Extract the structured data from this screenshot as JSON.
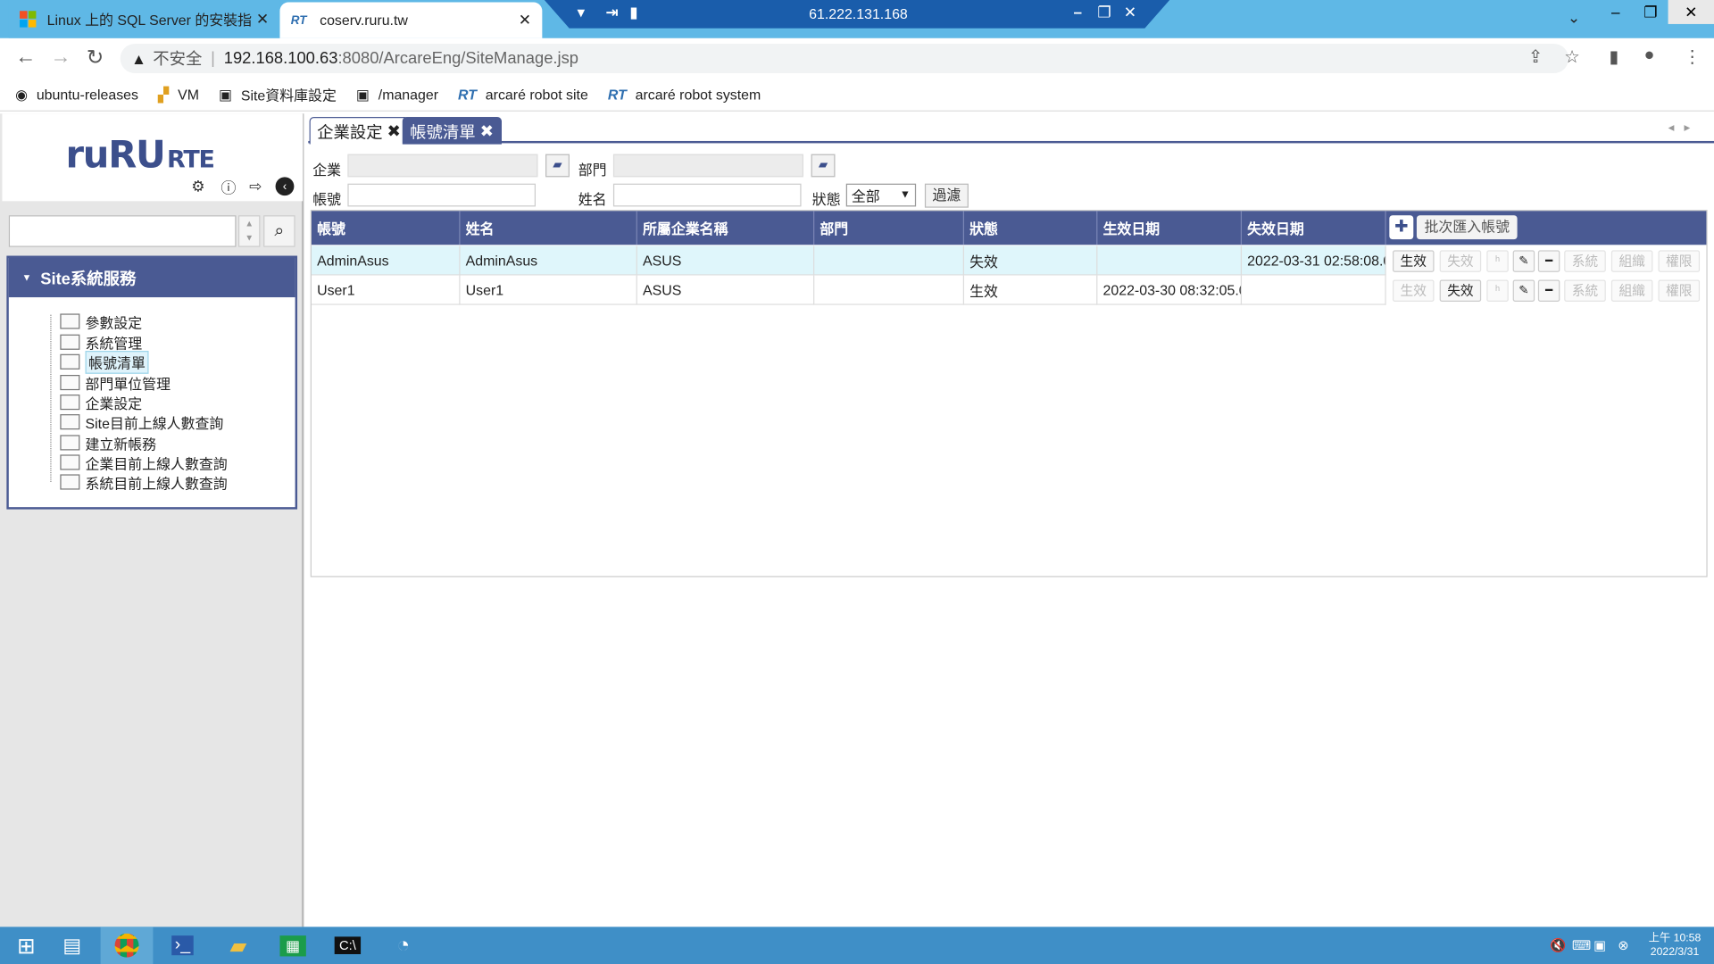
{
  "browser": {
    "tabs": [
      {
        "title": "Linux 上的 SQL Server 的安裝指"
      },
      {
        "title": "coserv.ruru.tw"
      }
    ],
    "rdp_ip": "61.222.131.168",
    "url_security": "不安全",
    "url_host": "192.168.100.63",
    "url_path": ":8080/ArcareEng/SiteManage.jsp",
    "bookmarks": [
      {
        "label": "ubuntu-releases"
      },
      {
        "label": "VM"
      },
      {
        "label": "Site資料庫設定"
      },
      {
        "label": "/manager"
      },
      {
        "label": "arcaré robot site"
      },
      {
        "label": "arcaré robot system"
      }
    ],
    "rt_badge": "RT"
  },
  "sidebar": {
    "logo": "ruRU",
    "logo_suffix": "RTE",
    "section_title": "Site系統服務",
    "items": [
      {
        "label": "參數設定"
      },
      {
        "label": "系統管理"
      },
      {
        "label": "帳號清單"
      },
      {
        "label": "部門單位管理"
      },
      {
        "label": "企業設定"
      },
      {
        "label": "Site目前上線人數查詢"
      },
      {
        "label": "建立新帳務"
      },
      {
        "label": "企業目前上線人數查詢"
      },
      {
        "label": "系統目前上線人數查詢"
      }
    ]
  },
  "main_tabs": [
    {
      "label": "企業設定"
    },
    {
      "label": "帳號清單"
    }
  ],
  "filters": {
    "company_label": "企業",
    "dept_label": "部門",
    "account_label": "帳號",
    "name_label": "姓名",
    "status_label": "狀態",
    "status_value": "全部",
    "filter_button": "過濾"
  },
  "table": {
    "columns": [
      "帳號",
      "姓名",
      "所屬企業名稱",
      "部門",
      "狀態",
      "生效日期",
      "失效日期"
    ],
    "batch_import": "批次匯入帳號",
    "rows": [
      {
        "account": "AdminAsus",
        "name": "AdminAsus",
        "company": "ASUS",
        "dept": "",
        "status": "失效",
        "effective": "",
        "expire": "2022-03-31 02:58:08.0"
      },
      {
        "account": "User1",
        "name": "User1",
        "company": "ASUS",
        "dept": "",
        "status": "生效",
        "effective": "2022-03-30 08:32:05.0",
        "expire": ""
      }
    ],
    "action_labels": {
      "activate": "生效",
      "deactivate": "失效",
      "system": "系統",
      "org": "組織",
      "perm": "權限"
    }
  },
  "taskbar": {
    "time": "上午 10:58",
    "date": "2022/3/31"
  },
  "colors": {
    "accent": "#4a5a93",
    "titlebar": "#5fb8e6",
    "taskbar": "#3f8fc7",
    "row_highlight": "#dff6fb"
  }
}
